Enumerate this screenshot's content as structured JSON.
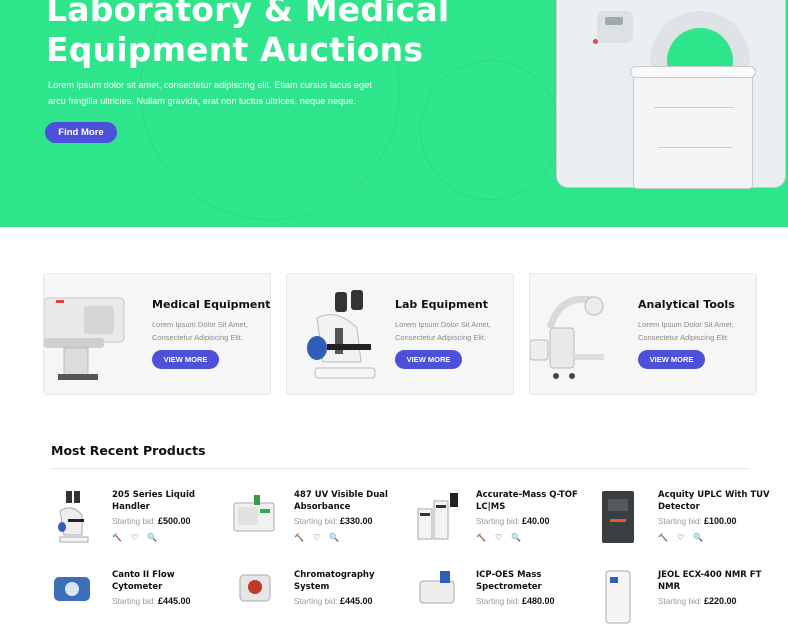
{
  "hero": {
    "title_line1": "Laboratory & Medical",
    "title_line2": "Equipment Auctions",
    "desc_line1": "Lorem ipsum dolor sit amet, consectetur adipiscing elit. Etiam cursus lacus eget",
    "desc_line2": "arcu fringilla ultricies. Nullam gravida, erat non luctus ultrices, neque neque.",
    "button": "Find More",
    "bg_color": "#2ee58b",
    "accent_color": "#4d50d8"
  },
  "categories": [
    {
      "title": "Medical Equipment",
      "desc": "Lorem Ipsum Dolor Sit Amet, Consectetur Adipiscing Elit.",
      "button": "VIEW MORE"
    },
    {
      "title": "Lab Equipment",
      "desc": "Lorem Ipsum Dolor Sit Amet, Consectetur Adipiscing Elit.",
      "button": "VIEW MORE"
    },
    {
      "title": "Analytical Tools",
      "desc": "Lorem Ipsum Dolor Sit Amet, Consectetur Adipiscing Elit.",
      "button": "VIEW MORE"
    }
  ],
  "recent": {
    "title": "Most Recent Products",
    "bid_label": "Starting bid:",
    "action_icons": [
      "hammer-icon",
      "heart-icon",
      "zoom-icon"
    ],
    "products": [
      {
        "name": "205 Series Liquid Handler",
        "price": "£500.00"
      },
      {
        "name": "487 UV Visible Dual Absorbance",
        "price": "£330.00"
      },
      {
        "name": "Accurate-Mass Q-TOF LC|MS",
        "price": "£40.00"
      },
      {
        "name": "Acquity UPLC With TUV Detector",
        "price": "£100.00"
      },
      {
        "name": "Canto II Flow Cytometer",
        "price": "£445.00"
      },
      {
        "name": "Chromatography System",
        "price": "£445.00"
      },
      {
        "name": "ICP-OES Mass Spectrometer",
        "price": "£480.00"
      },
      {
        "name": "JEOL ECX-400 NMR FT NMR",
        "price": "£220.00"
      }
    ]
  }
}
